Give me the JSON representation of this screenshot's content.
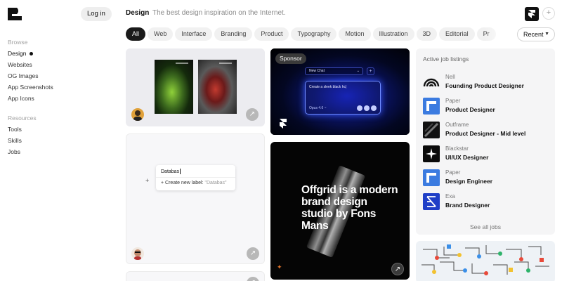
{
  "auth": {
    "login_label": "Log in"
  },
  "sidebar": {
    "browse_heading": "Browse",
    "browse_items": [
      {
        "label": "Design",
        "active": true
      },
      {
        "label": "Websites"
      },
      {
        "label": "OG Images"
      },
      {
        "label": "App Screenshots"
      },
      {
        "label": "App Icons"
      }
    ],
    "resources_heading": "Resources",
    "resource_items": [
      {
        "label": "Tools"
      },
      {
        "label": "Skills"
      },
      {
        "label": "Jobs"
      }
    ]
  },
  "header": {
    "title": "Design",
    "subtitle": "The best design inspiration on the Internet."
  },
  "filters": {
    "chips": [
      "All",
      "Web",
      "Interface",
      "Branding",
      "Product",
      "Typography",
      "Motion",
      "Illustration",
      "3D",
      "Editorial",
      "Pr"
    ],
    "active": "All",
    "sort_label": "Recent"
  },
  "cards": {
    "sponsor_badge": "Sponsor",
    "label_demo": {
      "input_value": "Databas",
      "create_text": "Create new label:",
      "create_value": "\"Databas\""
    },
    "chat_demo": {
      "new_chat": "New Chat",
      "prompt": "Create a sleek black hc|",
      "model": "Opus 4.6 ~"
    },
    "offgrid_text": "Offgrid is a modern brand design studio by Fons Mans"
  },
  "jobs": {
    "title": "Active job listings",
    "listings": [
      {
        "company": "Nell",
        "role": "Founding Product Designer",
        "logo": "nell-logo"
      },
      {
        "company": "Paper",
        "role": "Product Designer",
        "logo": "paper-logo"
      },
      {
        "company": "Outframe",
        "role": "Product Designer - Mid level",
        "logo": "outframe-logo"
      },
      {
        "company": "Blackstar",
        "role": "UI/UX Designer",
        "logo": "blackstar-logo"
      },
      {
        "company": "Paper",
        "role": "Design Engineer",
        "logo": "paper-logo"
      },
      {
        "company": "Exa",
        "role": "Brand Designer",
        "logo": "exa-logo"
      }
    ],
    "see_all": "See all jobs"
  },
  "colors": {
    "accent_dark": "#1a1a1a",
    "paper_blue": "#3b7be0",
    "exa_blue": "#1f3fc7",
    "sponsor_glow": "#1b2cff"
  }
}
